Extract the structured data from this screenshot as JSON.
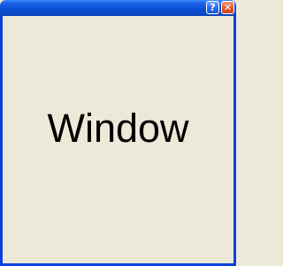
{
  "window": {
    "title": "",
    "content_text": "Window"
  },
  "titlebar": {
    "help_glyph": "?",
    "close_glyph": "✕"
  },
  "colors": {
    "titlebar": "#0A4FD6",
    "client_background": "#ECE9D8",
    "close_button": "#E25A2E",
    "help_button": "#2C6EF0"
  },
  "icons": {
    "help": "help-icon",
    "close": "close-icon"
  }
}
